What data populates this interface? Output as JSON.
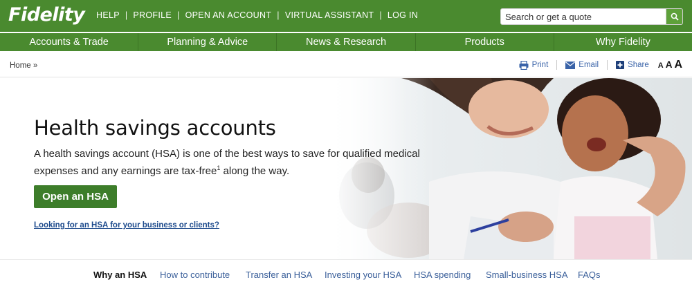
{
  "header": {
    "logo": "Fidelity",
    "util_links": [
      "HELP",
      "PROFILE",
      "OPEN AN ACCOUNT",
      "VIRTUAL ASSISTANT",
      "LOG IN"
    ],
    "search_placeholder": "Search or get a quote"
  },
  "main_nav": [
    "Accounts & Trade",
    "Planning & Advice",
    "News & Research",
    "Products",
    "Why Fidelity"
  ],
  "breadcrumb": "Home »",
  "tools": {
    "print": "Print",
    "email": "Email",
    "share": "Share",
    "font_sizes": [
      "A",
      "A",
      "A"
    ]
  },
  "hero": {
    "title": "Health savings accounts",
    "desc_before": "A health savings account (HSA) is one of the best ways to save for qualified medical expenses and any earnings are tax-free",
    "footnote": "1",
    "desc_after": " along the way.",
    "cta": "Open an HSA",
    "biz_link": "Looking for an HSA for your business or clients?"
  },
  "subtabs": [
    "Why an HSA",
    "How to contribute",
    "Transfer an HSA",
    "Investing your HSA",
    "HSA spending",
    "Small-business HSA",
    "FAQs"
  ],
  "colors": {
    "brand_green": "#4a8a2f",
    "cta_green": "#3d7d2a",
    "link_blue": "#3a63a8"
  }
}
